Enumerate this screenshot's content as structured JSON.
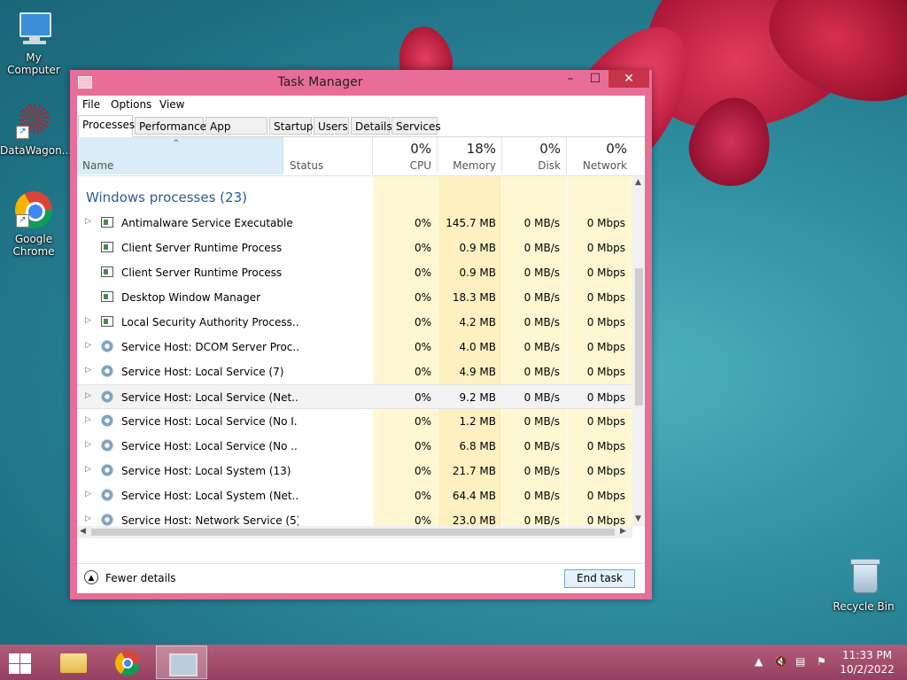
{
  "desktop": {
    "icons": {
      "my_computer": "My Computer",
      "datawagon": "DataWagon...",
      "chrome": "Google Chrome",
      "recycle_bin": "Recycle Bin"
    }
  },
  "window": {
    "title": "Task Manager",
    "controls": {
      "minimize": "–",
      "maximize": "☐",
      "close": "✕"
    },
    "menu": [
      "File",
      "Options",
      "View"
    ],
    "tabs": [
      "Processes",
      "Performance",
      "App history",
      "Startup",
      "Users",
      "Details",
      "Services"
    ],
    "active_tab": "Processes"
  },
  "columns": {
    "name": "Name",
    "status": "Status",
    "cpu": {
      "pct": "0%",
      "label": "CPU"
    },
    "memory": {
      "pct": "18%",
      "label": "Memory"
    },
    "disk": {
      "pct": "0%",
      "label": "Disk"
    },
    "network": {
      "pct": "0%",
      "label": "Network"
    }
  },
  "group_title": "Windows processes (23)",
  "processes": [
    {
      "name": "Antimalware Service Executable",
      "cpu": "0%",
      "memory": "145.7 MB",
      "disk": "0 MB/s",
      "network": "0 Mbps",
      "expandable": true,
      "icon": "app-icon"
    },
    {
      "name": "Client Server Runtime Process",
      "cpu": "0%",
      "memory": "0.9 MB",
      "disk": "0 MB/s",
      "network": "0 Mbps",
      "expandable": false,
      "icon": "app-icon"
    },
    {
      "name": "Client Server Runtime Process",
      "cpu": "0%",
      "memory": "0.9 MB",
      "disk": "0 MB/s",
      "network": "0 Mbps",
      "expandable": false,
      "icon": "app-icon"
    },
    {
      "name": "Desktop Window Manager",
      "cpu": "0%",
      "memory": "18.3 MB",
      "disk": "0 MB/s",
      "network": "0 Mbps",
      "expandable": false,
      "icon": "app-icon"
    },
    {
      "name": "Local Security Authority Process...",
      "cpu": "0%",
      "memory": "4.2 MB",
      "disk": "0 MB/s",
      "network": "0 Mbps",
      "expandable": true,
      "icon": "app-icon"
    },
    {
      "name": "Service Host: DCOM Server Proc...",
      "cpu": "0%",
      "memory": "4.0 MB",
      "disk": "0 MB/s",
      "network": "0 Mbps",
      "expandable": true,
      "icon": "gear-icon"
    },
    {
      "name": "Service Host: Local Service (7)",
      "cpu": "0%",
      "memory": "4.9 MB",
      "disk": "0 MB/s",
      "network": "0 Mbps",
      "expandable": true,
      "icon": "gear-icon"
    },
    {
      "name": "Service Host: Local Service (Net...",
      "cpu": "0%",
      "memory": "9.2 MB",
      "disk": "0 MB/s",
      "network": "0 Mbps",
      "expandable": true,
      "icon": "gear-icon",
      "selected": true
    },
    {
      "name": "Service Host: Local Service (No I...",
      "cpu": "0%",
      "memory": "1.2 MB",
      "disk": "0 MB/s",
      "network": "0 Mbps",
      "expandable": true,
      "icon": "gear-icon"
    },
    {
      "name": "Service Host: Local Service (No ...",
      "cpu": "0%",
      "memory": "6.8 MB",
      "disk": "0 MB/s",
      "network": "0 Mbps",
      "expandable": true,
      "icon": "gear-icon"
    },
    {
      "name": "Service Host: Local System (13)",
      "cpu": "0%",
      "memory": "21.7 MB",
      "disk": "0 MB/s",
      "network": "0 Mbps",
      "expandable": true,
      "icon": "gear-icon"
    },
    {
      "name": "Service Host: Local System (Net...",
      "cpu": "0%",
      "memory": "64.4 MB",
      "disk": "0 MB/s",
      "network": "0 Mbps",
      "expandable": true,
      "icon": "gear-icon"
    },
    {
      "name": "Service Host: Network Service (5)",
      "cpu": "0%",
      "memory": "23.0 MB",
      "disk": "0 MB/s",
      "network": "0 Mbps",
      "expandable": true,
      "icon": "gear-icon"
    }
  ],
  "footer": {
    "fewer_details": "Fewer details",
    "end_task": "End task"
  },
  "taskbar": {
    "time": "11:33 PM",
    "date": "10/2/2022",
    "tray_icons": [
      "chevron-up-icon",
      "volume-muted-icon",
      "network-icon",
      "action-center-icon"
    ]
  },
  "colors": {
    "window_border": "#e86e98",
    "close_button": "#c7344a",
    "heat_cell": "#fff7d1",
    "group_title": "#2a5d96",
    "taskbar": "#a7516e"
  }
}
